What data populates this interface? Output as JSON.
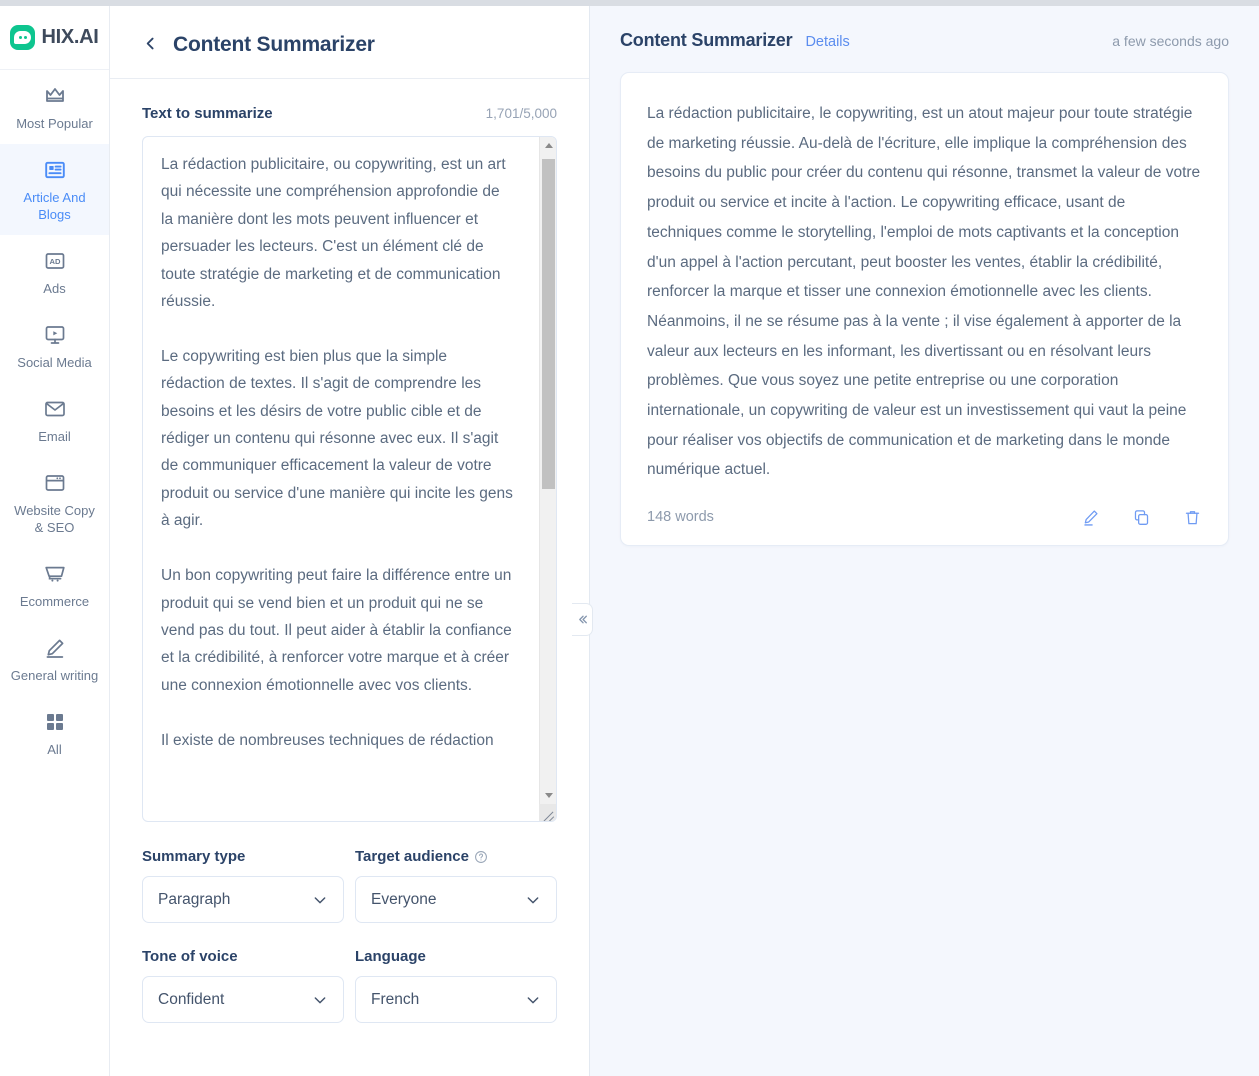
{
  "brand": {
    "name": "HIX.AI",
    "logo_icon": "chat-bubble-icon",
    "accent_green": "#0ec58f"
  },
  "colors": {
    "accent_blue": "#4a8cf7",
    "text_dark": "#2b4368",
    "text_body": "#5b6b80",
    "muted": "#8d9aac",
    "panel_bg": "#f4f7fd"
  },
  "sidebar": {
    "items": [
      {
        "label": "Most Popular",
        "icon": "crown-icon",
        "active": false
      },
      {
        "label": "Article And Blogs",
        "icon": "article-icon",
        "active": true
      },
      {
        "label": "Ads",
        "icon": "ad-icon",
        "active": false
      },
      {
        "label": "Social Media",
        "icon": "monitor-play-icon",
        "active": false
      },
      {
        "label": "Email",
        "icon": "envelope-icon",
        "active": false
      },
      {
        "label": "Website Copy & SEO",
        "icon": "browser-window-icon",
        "active": false
      },
      {
        "label": "Ecommerce",
        "icon": "shopping-cart-icon",
        "active": false
      },
      {
        "label": "General writing",
        "icon": "pencil-icon",
        "active": false
      },
      {
        "label": "All",
        "icon": "grid-icon",
        "active": false
      }
    ]
  },
  "middle": {
    "back_icon": "chevron-left-icon",
    "title": "Content Summarizer",
    "input": {
      "label": "Text to summarize",
      "counter": "1,701/5,000",
      "value": "La rédaction publicitaire, ou copywriting, est un art qui nécessite une compréhension approfondie de la manière dont les mots peuvent influencer et persuader les lecteurs. C'est un élément clé de toute stratégie de marketing et de communication réussie.\n\nLe copywriting est bien plus que la simple rédaction de textes. Il s'agit de comprendre les besoins et les désirs de votre public cible et de rédiger un contenu qui résonne avec eux. Il s'agit de communiquer efficacement la valeur de votre produit ou service d'une manière qui incite les gens à agir.\n\nUn bon copywriting peut faire la différence entre un produit qui se vend bien et un produit qui ne se vend pas du tout. Il peut aider à établir la confiance et la crédibilité, à renforcer votre marque et à créer une connexion émotionnelle avec vos clients.\n\nIl existe de nombreuses techniques de rédaction",
      "scrollbar": {
        "up_icon": "scroll-up-arrow-icon",
        "down_icon": "scroll-down-arrow-icon"
      },
      "resize_icon": "resize-grip-icon"
    },
    "fields": [
      {
        "label": "Summary type",
        "value": "Paragraph",
        "help": false,
        "chevron_icon": "chevron-down-icon"
      },
      {
        "label": "Target audience",
        "value": "Everyone",
        "help": true,
        "help_icon": "question-circle-icon",
        "chevron_icon": "chevron-down-icon"
      },
      {
        "label": "Tone of voice",
        "value": "Confident",
        "help": false,
        "chevron_icon": "chevron-down-icon"
      },
      {
        "label": "Language",
        "value": "French",
        "help": false,
        "chevron_icon": "chevron-down-icon"
      }
    ]
  },
  "right": {
    "title": "Content Summarizer",
    "details_label": "Details",
    "timestamp": "a few seconds ago",
    "result": "La rédaction publicitaire, le copywriting, est un atout majeur pour toute stratégie de marketing réussie. Au-delà de l'écriture, elle implique la compréhension des besoins du public pour créer du contenu qui résonne, transmet la valeur de votre produit ou service et incite à l'action. Le copywriting efficace, usant de techniques comme le storytelling, l'emploi de mots captivants et la conception d'un appel à l'action percutant, peut booster les ventes, établir la crédibilité, renforcer la marque et tisser une connexion émotionnelle avec les clients. Néanmoins, il ne se résume pas à la vente ; il vise également à apporter de la valeur aux lecteurs en les informant, les divertissant ou en résolvant leurs problèmes. Que vous soyez une petite entreprise ou une corporation internationale, un copywriting de valeur est un investissement qui vaut la peine pour réaliser vos objectifs de communication et de marketing dans le monde numérique actuel.",
    "word_count": "148 words",
    "actions": [
      {
        "name": "edit",
        "icon": "pencil-edit-icon"
      },
      {
        "name": "copy",
        "icon": "copy-icon"
      },
      {
        "name": "delete",
        "icon": "trash-icon"
      }
    ],
    "collapse_icon": "double-chevron-left-icon"
  }
}
